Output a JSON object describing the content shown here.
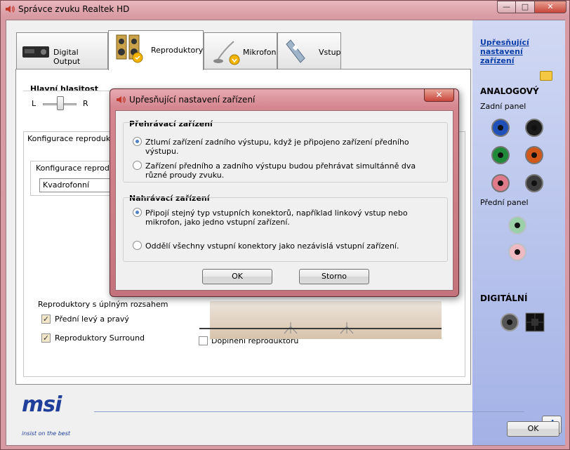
{
  "window": {
    "title": "Správce zvuku Realtek HD",
    "caption_min": "—",
    "caption_max": "□",
    "caption_close": "✕"
  },
  "tabs": [
    {
      "label": "Digital Output",
      "icon": "receiver-icon",
      "active": false
    },
    {
      "label": "Reproduktory",
      "icon": "speakers-icon",
      "active": true
    },
    {
      "label": "Mikrofon",
      "icon": "microphone-icon",
      "active": false
    },
    {
      "label": "Vstup",
      "icon": "input-device-icon",
      "active": false
    }
  ],
  "panel": {
    "master_volume_label": "Hlavní hlasitost",
    "left_label": "L",
    "right_label": "R",
    "speaker_config_group": "Konfigurace reproduktorů",
    "speaker_config_label": "Konfigurace reproduktorů",
    "speaker_config_value": "Kvadrofonní",
    "fullrange_label": "Reproduktory s úplným rozsahem",
    "front_lr_label": "Přední levý a pravý",
    "front_lr_checked": true,
    "surround_label": "Reproduktory Surround",
    "surround_checked": true,
    "speaker_fill_label": "Doplnění reproduktorů",
    "speaker_fill_checked": false
  },
  "sidebar": {
    "link": "Upřesňující nastavení zařízení",
    "analog_header": "ANALOGOVÝ",
    "back_panel": "Zadní panel",
    "front_panel": "Přední panel",
    "digital_header": "DIGITÁLNÍ",
    "jack_colors": {
      "blue": "#1f4fb8",
      "black": "#1a1a1a",
      "green": "#1f8a3a",
      "orange": "#d2581a",
      "pink": "#e07a8a",
      "gray": "#3c3c3c",
      "front_green": "#9ad0a8",
      "front_pink": "#efb9c4"
    }
  },
  "branding": {
    "logo": "msi",
    "tagline": "insist on the best",
    "brand_color": "#1f3f9a"
  },
  "footer": {
    "info_label": "i",
    "ok_label": "OK"
  },
  "dialog": {
    "title": "Upřesňující nastavení zařízení",
    "close_label": "✕",
    "playback_title": "Přehrávací zařízení",
    "playback_options": [
      {
        "label": "Ztlumí zařízení zadního výstupu, když je připojeno zařízení předního výstupu.",
        "selected": true
      },
      {
        "label": "Zařízení předního a zadního výstupu budou přehrávat simultánně dva různé proudy zvuku.",
        "selected": false
      }
    ],
    "recording_title": "Nahrávací zařízení",
    "recording_options": [
      {
        "label": "Připojí stejný typ vstupních konektorů, například linkový vstup nebo mikrofon, jako jedno vstupní zařízení.",
        "selected": true
      },
      {
        "label": "Oddělí všechny vstupní konektory jako nezávislá vstupní zařízení.",
        "selected": false
      }
    ],
    "ok_label": "OK",
    "cancel_label": "Storno"
  }
}
